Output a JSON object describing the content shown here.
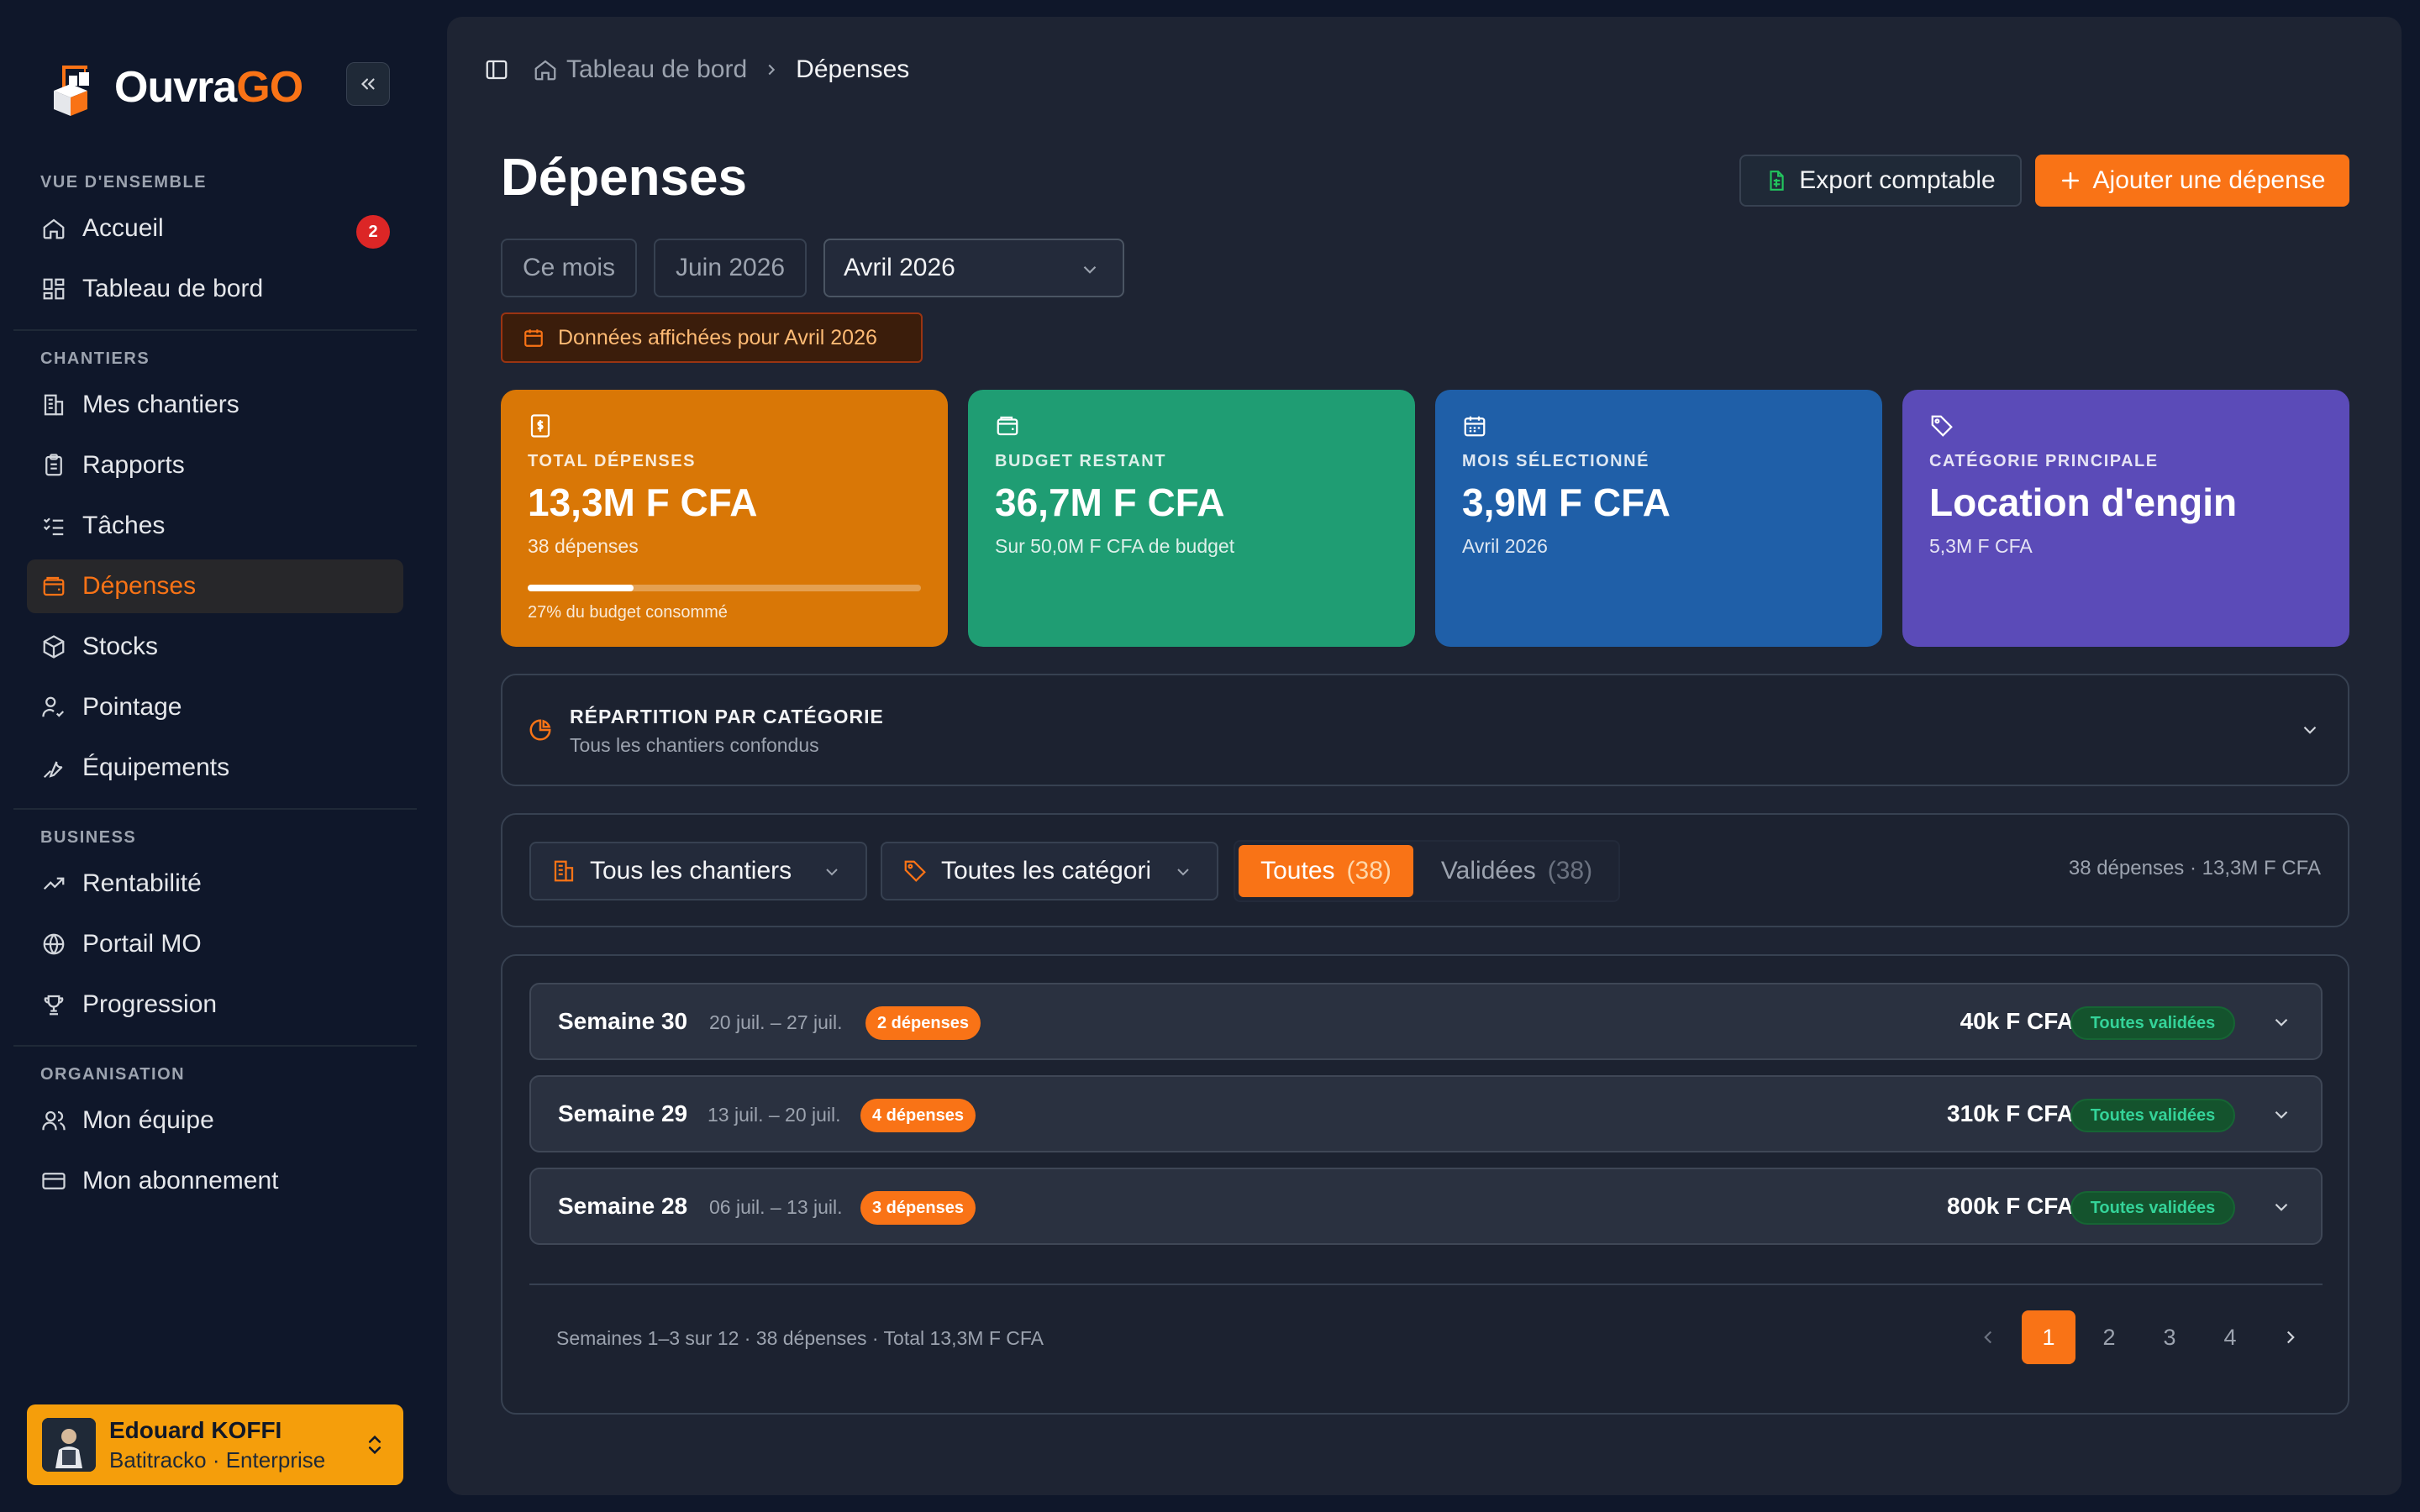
{
  "brand": {
    "name_main": "Ouvra",
    "name_accent": "GO"
  },
  "sidebar": {
    "sections": [
      {
        "title": "VUE D'ENSEMBLE",
        "items": [
          {
            "label": "Accueil",
            "icon": "home-icon",
            "badge": "2"
          },
          {
            "label": "Tableau de bord",
            "icon": "dashboard-icon"
          }
        ]
      },
      {
        "title": "CHANTIERS",
        "items": [
          {
            "label": "Mes chantiers",
            "icon": "building-icon"
          },
          {
            "label": "Rapports",
            "icon": "clipboard-icon"
          },
          {
            "label": "Tâches",
            "icon": "checklist-icon"
          },
          {
            "label": "Dépenses",
            "icon": "wallet-icon",
            "active": true
          },
          {
            "label": "Stocks",
            "icon": "box-icon"
          },
          {
            "label": "Pointage",
            "icon": "user-check-icon"
          },
          {
            "label": "Équipements",
            "icon": "wrench-icon"
          }
        ]
      },
      {
        "title": "BUSINESS",
        "items": [
          {
            "label": "Rentabilité",
            "icon": "trending-up-icon"
          },
          {
            "label": "Portail MO",
            "icon": "globe-icon"
          },
          {
            "label": "Progression",
            "icon": "trophy-icon"
          }
        ]
      },
      {
        "title": "ORGANISATION",
        "items": [
          {
            "label": "Mon équipe",
            "icon": "users-icon"
          },
          {
            "label": "Mon abonnement",
            "icon": "credit-card-icon"
          }
        ]
      }
    ],
    "user": {
      "name": "Edouard KOFFI",
      "org": "Batitracko · Enterprise"
    }
  },
  "breadcrumb": {
    "home": "Tableau de bord",
    "current": "Dépenses"
  },
  "page": {
    "title": "Dépenses",
    "export_label": "Export comptable",
    "add_label": "Ajouter une dépense"
  },
  "periods": {
    "options": [
      "Ce mois",
      "Juin 2026"
    ],
    "selected": "Avril 2026",
    "banner": "Données affichées pour Avril 2026"
  },
  "stats": [
    {
      "label": "TOTAL DÉPENSES",
      "value": "13,3M F CFA",
      "sub": "38 dépenses",
      "progress": 0.27,
      "progress_caption": "27% du budget consommé",
      "color": "#d97706",
      "icon": "dollar-receipt-icon"
    },
    {
      "label": "BUDGET RESTANT",
      "value": "36,7M F CFA",
      "sub": "Sur 50,0M F CFA de budget",
      "color": "#1f9d73",
      "icon": "wallet-icon"
    },
    {
      "label": "MOIS SÉLECTIONNÉ",
      "value": "3,9M F CFA",
      "sub": "Avril 2026",
      "color": "#1f5fa8",
      "icon": "calendar-icon"
    },
    {
      "label": "CATÉGORIE PRINCIPALE",
      "value": "Location d'engin",
      "sub": "5,3M F CFA",
      "color": "#5b4bb8",
      "icon": "tag-icon"
    }
  ],
  "category_breakdown": {
    "title": "RÉPARTITION PAR CATÉGORIE",
    "subtitle": "Tous les chantiers confondus"
  },
  "filters": {
    "site": "Tous les chantiers",
    "category": "Toutes les catégories",
    "tabs": [
      {
        "label": "Toutes",
        "count": "(38)",
        "active": true
      },
      {
        "label": "Validées",
        "count": "(38)"
      }
    ],
    "summary": "38 dépenses · 13,3M F CFA"
  },
  "weeks": [
    {
      "title": "Semaine 30",
      "range": "20 juil. – 27 juil.",
      "badge": "2 dépenses",
      "amount": "40k F CFA",
      "status": "Toutes validées"
    },
    {
      "title": "Semaine 29",
      "range": "13 juil. – 20 juil.",
      "badge": "4 dépenses",
      "amount": "310k F CFA",
      "status": "Toutes validées"
    },
    {
      "title": "Semaine 28",
      "range": "06 juil. – 13 juil.",
      "badge": "3 dépenses",
      "amount": "800k F CFA",
      "status": "Toutes validées"
    }
  ],
  "pagination": {
    "summary": "Semaines 1–3 sur 12 · 38 dépenses · Total 13,3M F CFA",
    "pages": [
      "1",
      "2",
      "3",
      "4"
    ],
    "current": "1"
  }
}
